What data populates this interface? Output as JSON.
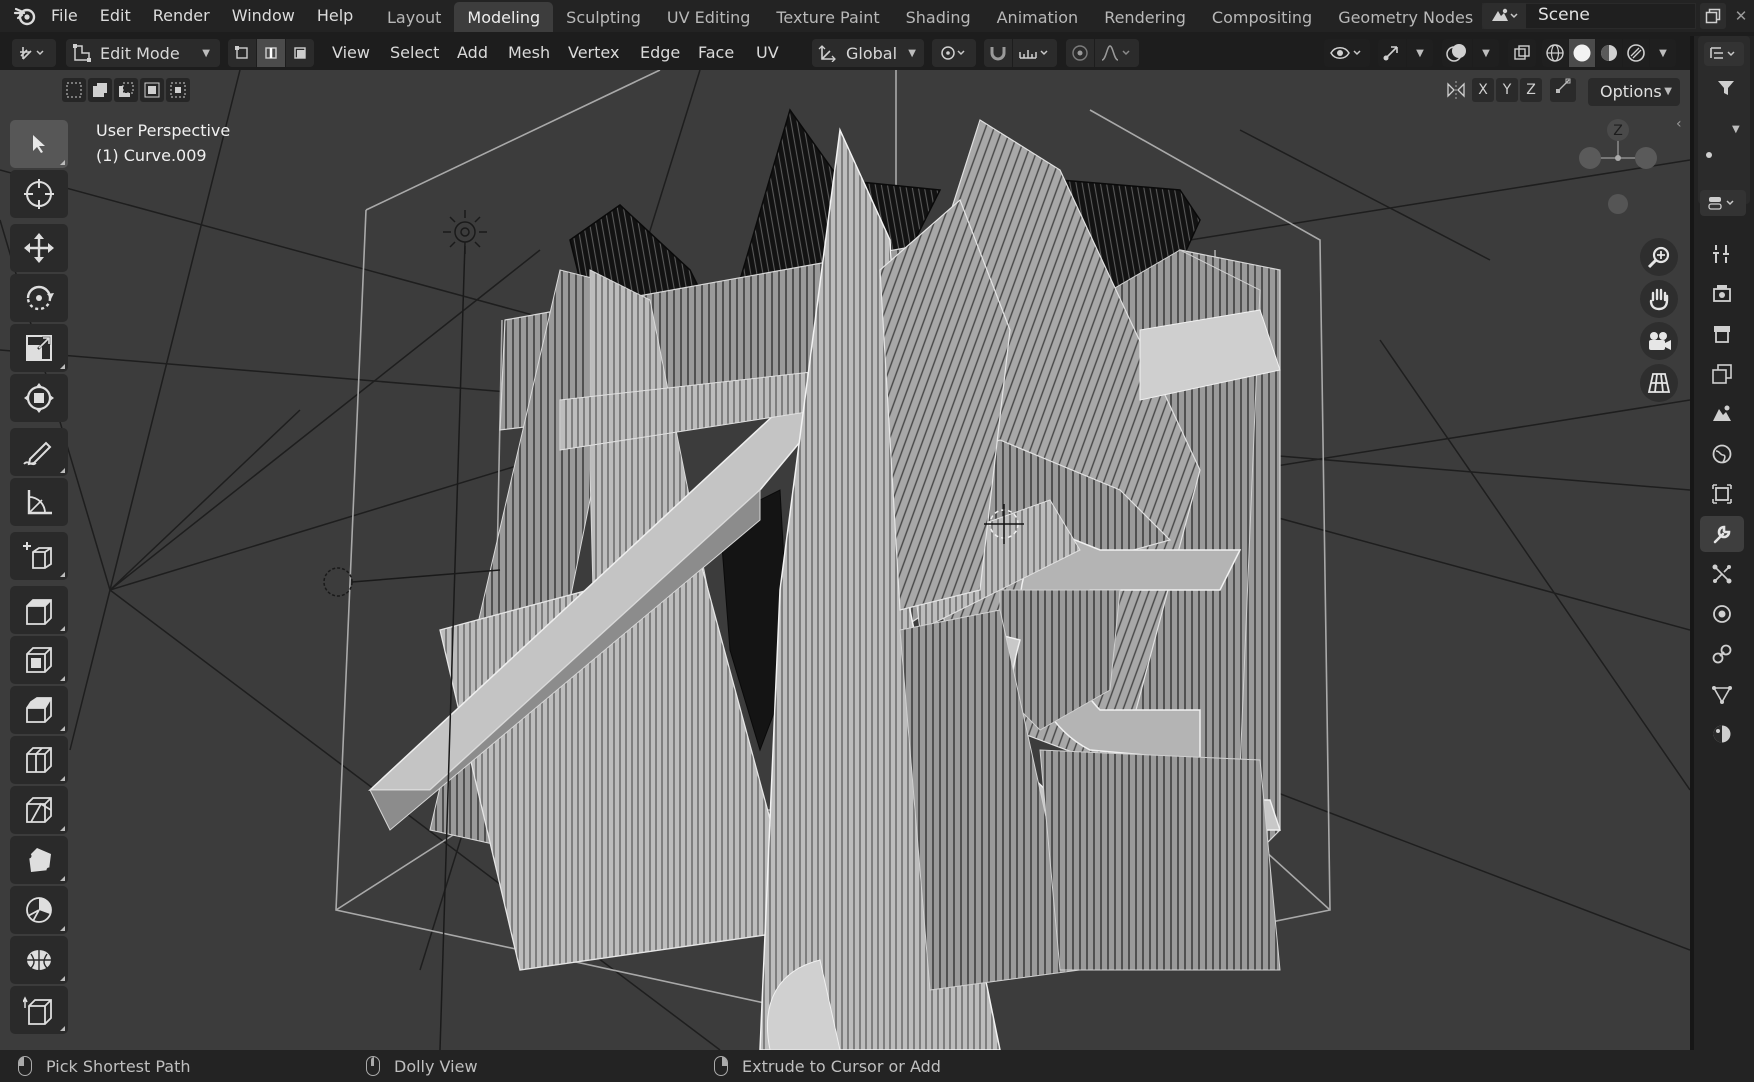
{
  "topbar": {
    "menus": [
      "File",
      "Edit",
      "Render",
      "Window",
      "Help"
    ],
    "workspaces": [
      "Layout",
      "Modeling",
      "Sculpting",
      "UV Editing",
      "Texture Paint",
      "Shading",
      "Animation",
      "Rendering",
      "Compositing",
      "Geometry Nodes"
    ],
    "active_workspace": "Modeling",
    "scene_name": "Scene"
  },
  "viewport_header": {
    "editor_type_icon": "3d-viewport-icon",
    "mode_label": "Edit Mode",
    "menus": [
      "View",
      "Select",
      "Add",
      "Mesh",
      "Vertex",
      "Edge",
      "Face",
      "UV"
    ],
    "transform_orientation": "Global",
    "options_label": "Options",
    "axes": [
      "X",
      "Y",
      "Z"
    ]
  },
  "overlay": {
    "view_name": "User Perspective",
    "object_name": "(1) Curve.009"
  },
  "gizmo": {
    "z_label": "Z"
  },
  "toolbar": [
    {
      "name": "select-box-tool",
      "icon": "cursor-arrow-icon",
      "active": true
    },
    {
      "name": "cursor-tool",
      "icon": "3d-cursor-icon"
    },
    {
      "name": "move-tool",
      "icon": "move-icon"
    },
    {
      "name": "rotate-tool",
      "icon": "rotate-icon"
    },
    {
      "name": "scale-tool",
      "icon": "scale-icon"
    },
    {
      "name": "transform-tool",
      "icon": "transform-icon"
    },
    {
      "name": "annotate-tool",
      "icon": "annotate-pencil-icon"
    },
    {
      "name": "measure-tool",
      "icon": "ruler-icon"
    },
    {
      "name": "add-cube-tool",
      "icon": "add-cube-icon"
    },
    {
      "name": "extrude-region-tool",
      "icon": "extrude-icon"
    },
    {
      "name": "inset-faces-tool",
      "icon": "inset-icon"
    },
    {
      "name": "bevel-tool",
      "icon": "bevel-icon"
    },
    {
      "name": "loop-cut-tool",
      "icon": "loop-cut-icon"
    },
    {
      "name": "knife-tool",
      "icon": "knife-icon"
    },
    {
      "name": "poly-build-tool",
      "icon": "poly-build-icon"
    },
    {
      "name": "spin-tool",
      "icon": "spin-icon"
    },
    {
      "name": "smooth-tool",
      "icon": "smooth-icon"
    },
    {
      "name": "shear-tool",
      "icon": "shear-icon"
    }
  ],
  "properties_tabs": [
    "tool-icon",
    "render-icon",
    "output-icon",
    "view-layer-icon",
    "scene-icon",
    "world-icon",
    "object-icon",
    "modifier-wrench-icon",
    "particles-icon",
    "physics-icon",
    "constraints-icon",
    "data-icon",
    "material-icon"
  ],
  "statusbar": {
    "left": "Pick Shortest Path",
    "middle": "Dolly View",
    "right": "Extrude to Cursor or Add"
  }
}
